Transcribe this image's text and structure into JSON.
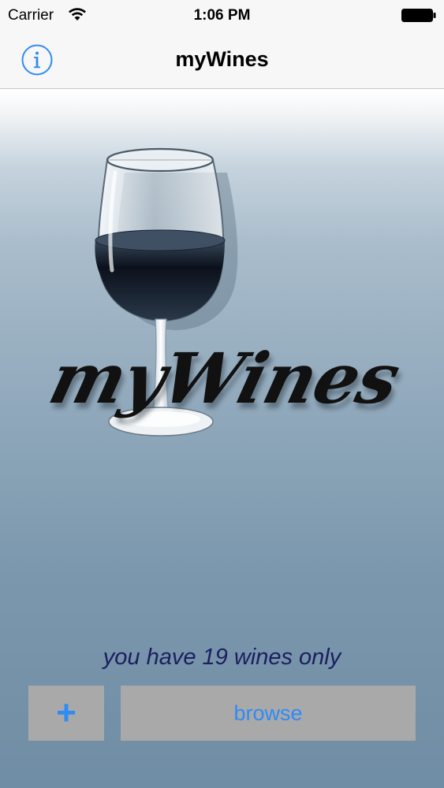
{
  "status_bar": {
    "carrier": "Carrier",
    "time": "1:06 PM"
  },
  "nav_bar": {
    "title": "myWines",
    "info_icon": "info-circle-icon"
  },
  "logo": {
    "text": "myWines"
  },
  "main": {
    "wine_count_text": "you have 19 wines only",
    "add_label": "+",
    "browse_label": "browse"
  },
  "colors": {
    "accent": "#2f8bf5",
    "count_text": "#1c1f5e",
    "button_bg": "#a9a9a9"
  }
}
